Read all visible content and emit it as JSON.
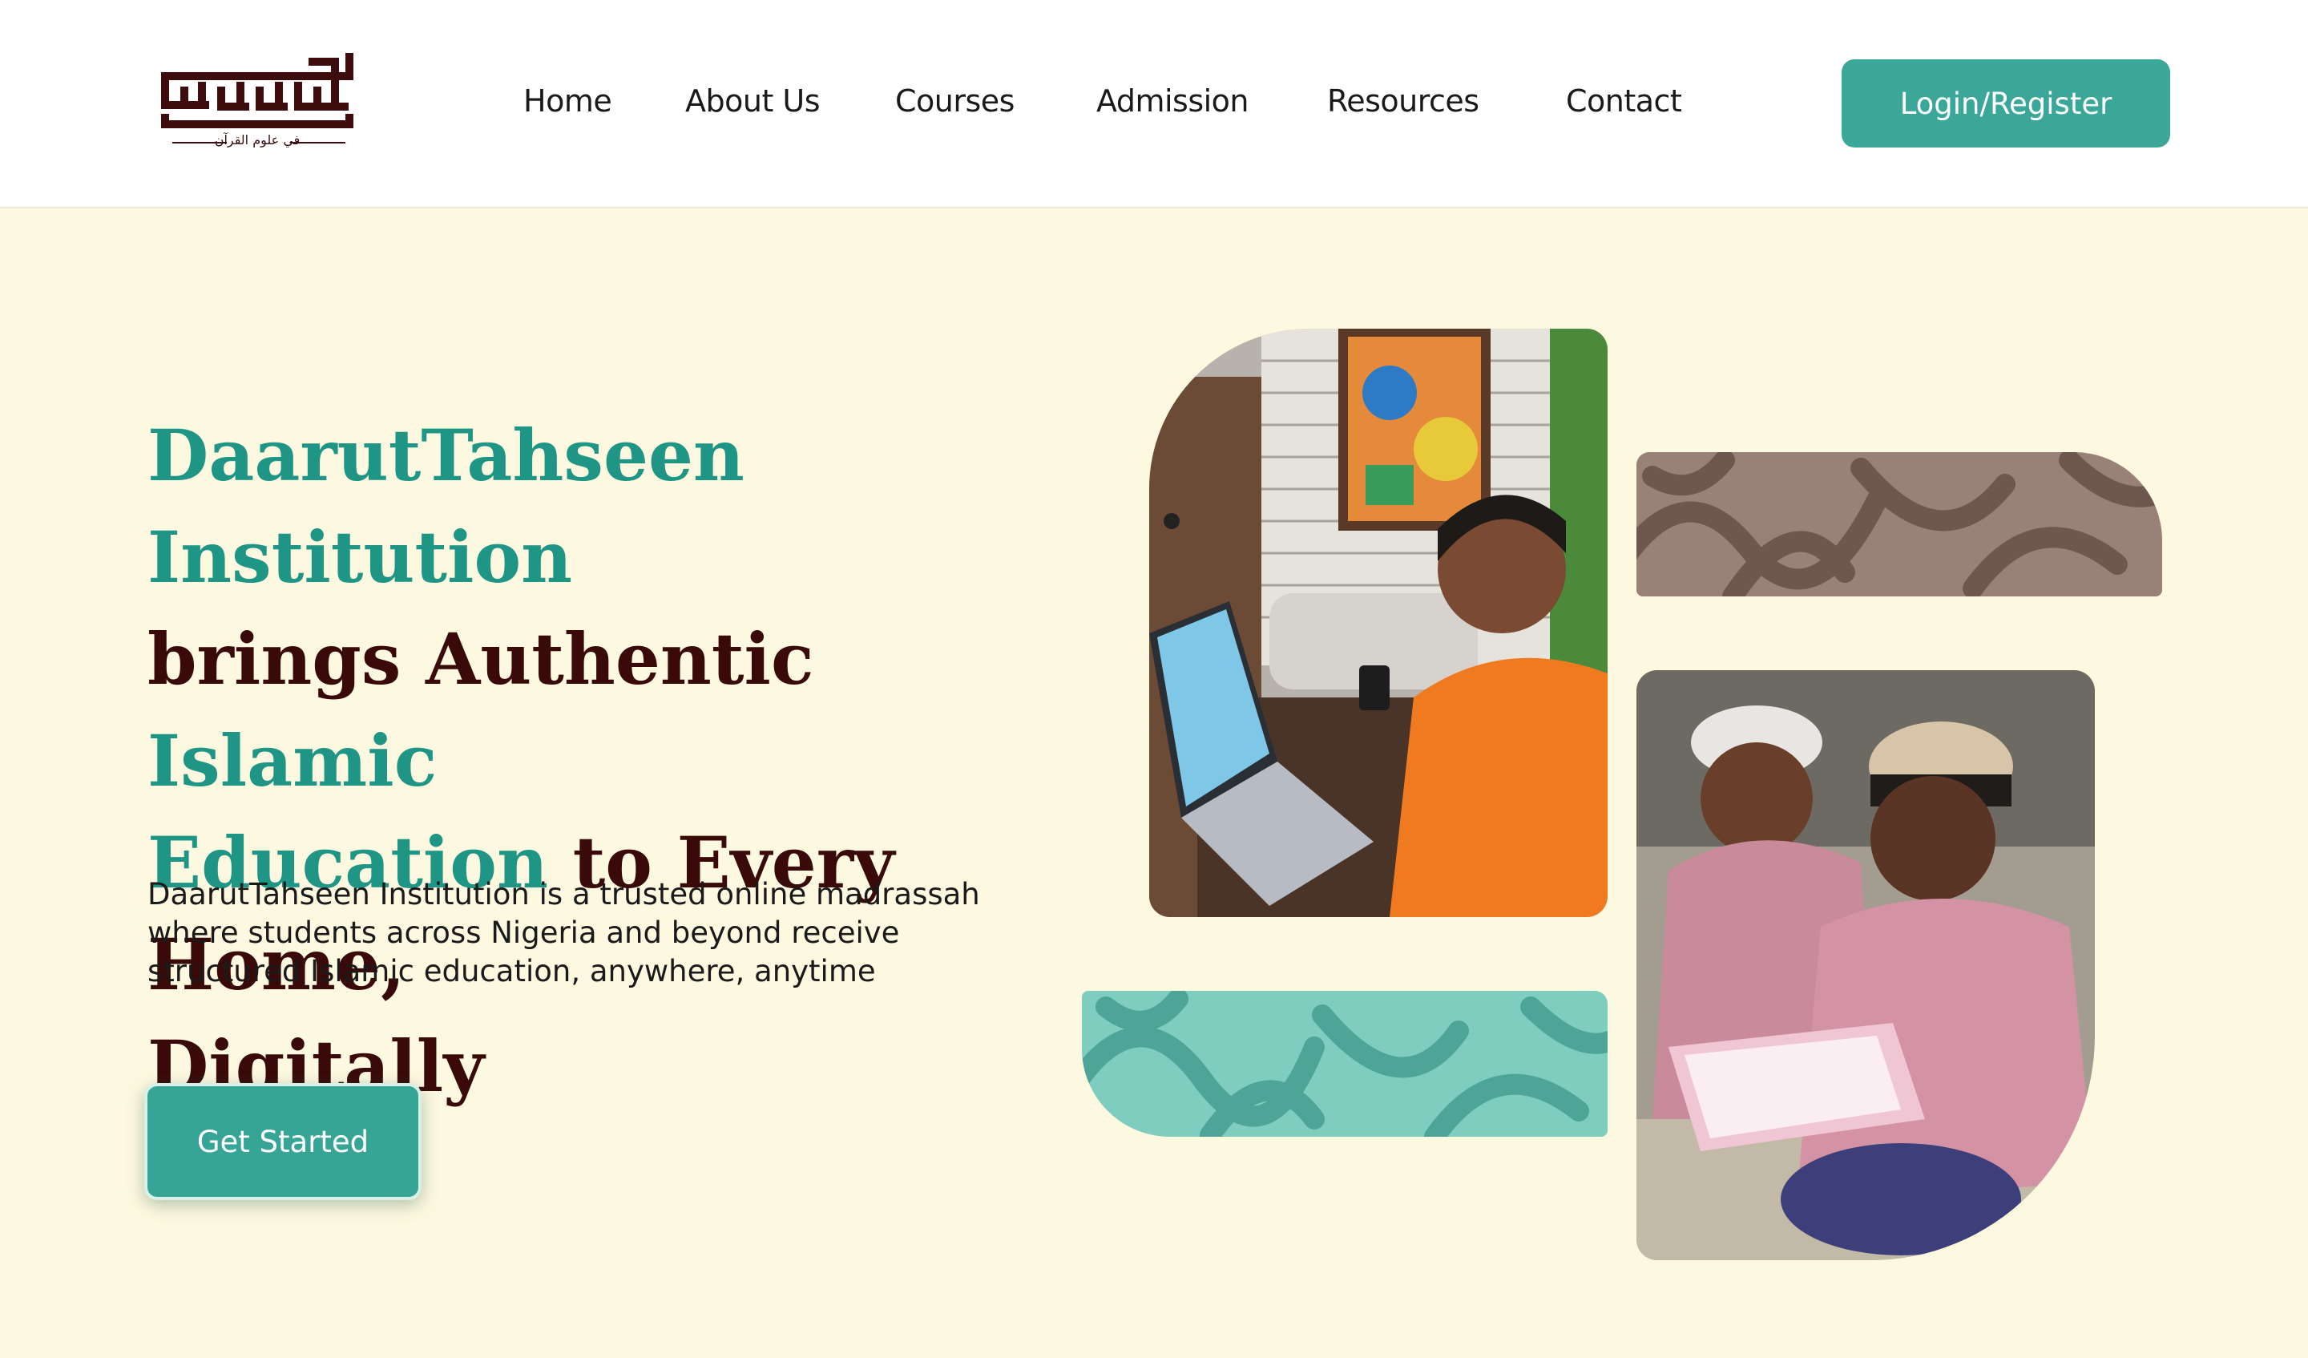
{
  "header": {
    "logo": {
      "name": "daaruttahseen-logo",
      "caption": "في علوم القرآن"
    },
    "nav": [
      {
        "label": "Home"
      },
      {
        "label": "About Us"
      },
      {
        "label": "Courses"
      },
      {
        "label": "Admission"
      },
      {
        "label": "Resources"
      },
      {
        "label": "Contact"
      }
    ],
    "login_label": "Login/Register"
  },
  "hero": {
    "headline": {
      "part1": "DaarutTahseen  Institution",
      "part2": "brings Authentic ",
      "part3": "Islamic",
      "part4": "Education",
      "part5": " to Every Home,",
      "part6": "Digitally"
    },
    "lead": "DaarutTahseen Institution is a trusted online madrassah where students across Nigeria and beyond receive structured Islamic education, anywhere, anytime",
    "cta_label": "Get Started"
  },
  "colors": {
    "background": "#fdf9e0",
    "teal": "#1e9585",
    "button_teal": "#3aa799",
    "maroon": "#3a0a0a",
    "pattern_brown": "#9a8177",
    "pattern_teal": "#7ecdbf"
  }
}
